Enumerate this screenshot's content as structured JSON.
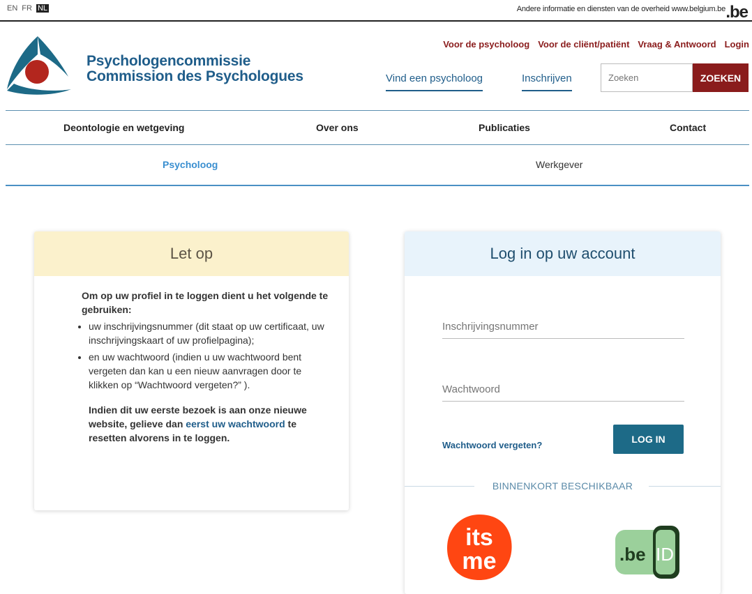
{
  "federal_bar": {
    "languages": [
      "EN",
      "FR",
      "NL"
    ],
    "active_language": "NL",
    "info_text": "Andere informatie en diensten van de overheid www.belgium.be",
    "be_logo": ".be"
  },
  "header": {
    "brand_line1": "Psychologencommissie",
    "brand_line2": "Commission des Psychologues",
    "top_links": [
      "Voor de psycholoog",
      "Voor de cliënt/patiënt",
      "Vraag & Antwoord",
      "Login"
    ],
    "find_psychologist": "Vind een psycholoog",
    "register": "Inschrijven",
    "search_placeholder": "Zoeken",
    "search_button": "ZOEKEN"
  },
  "menu": {
    "items": [
      "Deontologie en wetgeving",
      "Over ons",
      "Publicaties",
      "Contact"
    ],
    "sub_items": [
      "Psycholoog",
      "Werkgever"
    ],
    "active_sub": "Psycholoog"
  },
  "notice": {
    "title": "Let op",
    "intro": "Om op uw profiel in te loggen dient u het volgende te gebruiken:",
    "bullets": [
      "uw inschrijvingsnummer (dit staat op uw certificaat, uw inschrijvingskaart of uw profielpagina);",
      "en uw wachtwoord (indien u uw wachtwoord bent vergeten dan kan u een nieuw aanvragen door te klikken op “Wachtwoord vergeten?” )."
    ],
    "outro_before": "Indien dit uw eerste bezoek is aan onze nieuwe website, gelieve dan ",
    "outro_link": "eerst uw wachtwoord",
    "outro_after": " te resetten alvorens in te loggen."
  },
  "login": {
    "title": "Log in op uw account",
    "registration_placeholder": "Inschrijvingsnummer",
    "password_placeholder": "Wachtwoord",
    "forgot": "Wachtwoord vergeten?",
    "login_button": "LOG IN",
    "coming_soon": "BINNENKORT BESCHIKBAAR",
    "itsme_text": "its me",
    "beid_text": ".beID"
  },
  "colors": {
    "brand_blue": "#1f5d8a",
    "brand_red": "#8a1c1c",
    "login_button": "#1d6a87",
    "itsme_orange": "#ff4612",
    "beid_green": "#9bd09b"
  }
}
